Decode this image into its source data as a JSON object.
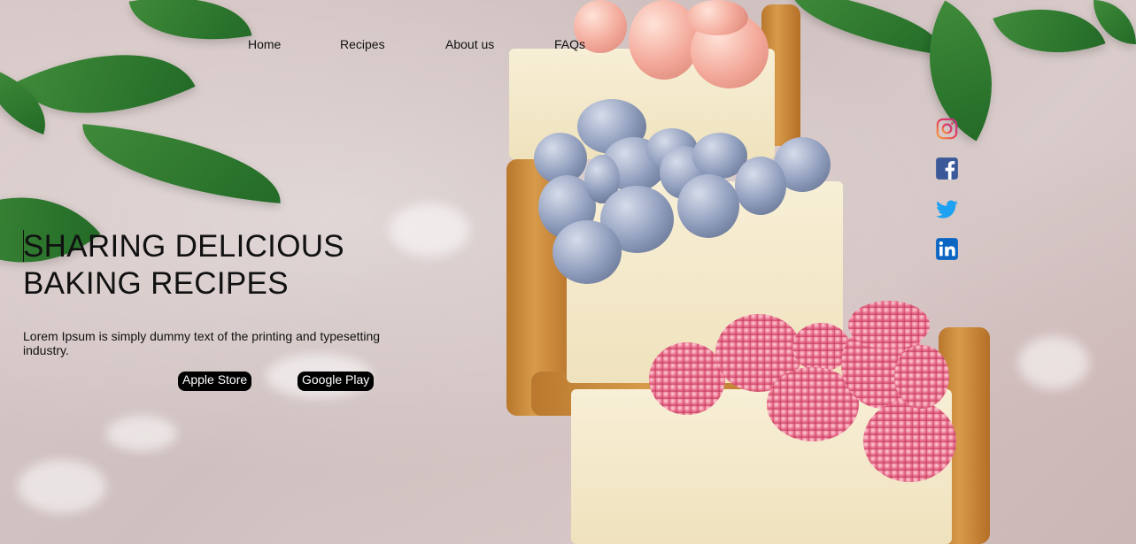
{
  "nav": {
    "items": [
      {
        "label": "Home"
      },
      {
        "label": "Recipes"
      },
      {
        "label": "About us"
      },
      {
        "label": "FAQs"
      }
    ]
  },
  "hero": {
    "title_line1": "SHARING DELICIOUS",
    "title_line2": "BAKING RECIPES",
    "description": "Lorem Ipsum is simply dummy text of the printing and typesetting industry."
  },
  "buttons": {
    "apple_store": "Apple Store",
    "google_play": "Google Play"
  },
  "social": [
    {
      "icon": "instagram-icon",
      "color": "#e4405f"
    },
    {
      "icon": "facebook-icon",
      "color": "#3b5998"
    },
    {
      "icon": "twitter-icon",
      "color": "#1da1f2"
    },
    {
      "icon": "linkedin-icon",
      "color": "#0a66c2"
    }
  ]
}
